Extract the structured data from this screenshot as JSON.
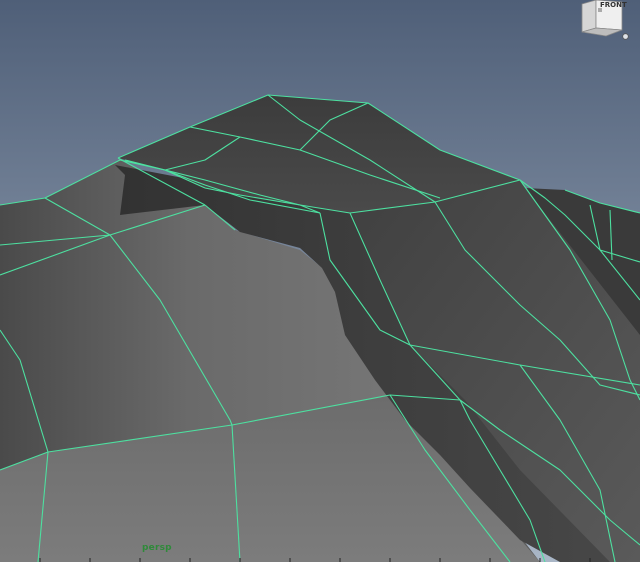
{
  "viewport": {
    "camera_label": "persp",
    "view_cube": {
      "face_label": "FRONT",
      "icon": "view-cube-icon"
    },
    "home_icon": "home-icon"
  },
  "colors": {
    "sky_top": "#4f5f78",
    "sky_bottom": "#a9b6c6",
    "wireframe": "#4de0a0",
    "mesh_dark": "#3a3a3a",
    "mesh_light": "#7a7a7a",
    "camera_label": "#2f8a3a"
  }
}
